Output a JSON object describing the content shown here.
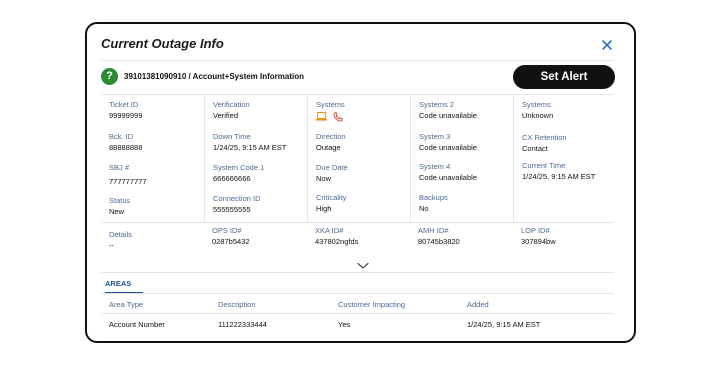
{
  "modal": {
    "title": "Current Outage Info",
    "account_line": "39101381090910 / Account+System Information",
    "set_alert_label": "Set Alert"
  },
  "fields": {
    "ticket_id": {
      "label": "Ticket ID",
      "value": "99999999"
    },
    "bck_id": {
      "label": "Bck. ID",
      "value": "88888888"
    },
    "sbj": {
      "label": "SBJ #",
      "value": "777777777"
    },
    "status": {
      "label": "Status",
      "value": "New"
    },
    "details": {
      "label": "Details",
      "value": "--"
    },
    "verification": {
      "label": "Verification",
      "value": "Verified"
    },
    "down_time": {
      "label": "Down Time",
      "value": "1/24/25, 9:15 AM EST"
    },
    "system_code_1": {
      "label": "System Code 1",
      "value": "666666666"
    },
    "connection_id": {
      "label": "Connection ID",
      "value": "555555555"
    },
    "ops_id": {
      "label": "OPS ID#",
      "value": "0287b5432"
    },
    "systems_icons": {
      "label": "Systems"
    },
    "direction": {
      "label": "Direction",
      "value": "Outage"
    },
    "due_date": {
      "label": "Due Date",
      "value": "Now"
    },
    "criticality": {
      "label": "Criticality",
      "value": "High"
    },
    "xka_id": {
      "label": "XKA ID#",
      "value": "437802ngfds"
    },
    "systems_2": {
      "label": "Systems 2",
      "value": "Code unavailable"
    },
    "system_3": {
      "label": "System 3",
      "value": "Code unavailable"
    },
    "system_4": {
      "label": "System 4",
      "value": "Code unavailable"
    },
    "backups": {
      "label": "Backups",
      "value": "No"
    },
    "amh_id": {
      "label": "AMH ID#",
      "value": "80745b3820"
    },
    "systems_unknown": {
      "label": "Systems",
      "value": "Unknown"
    },
    "cx_retention": {
      "label": "CX Retention",
      "value": "Contact"
    },
    "current_time": {
      "label": "Current Time",
      "value": "1/24/25, 9:15 AM EST"
    },
    "lop_id": {
      "label": "LOP ID#",
      "value": "307894bw"
    }
  },
  "icons": {
    "laptop": "laptop-icon",
    "phone": "phone-icon",
    "close": "close-icon",
    "expand": "chevron-down-icon",
    "status": "question-icon"
  },
  "colors": {
    "label_blue": "#4a6a96",
    "tab_blue": "#1e4f9a",
    "status_green": "#2e8b34",
    "laptop_orange": "#e8961e",
    "phone_red": "#d33a2c",
    "close_blue": "#2f6fc4"
  },
  "areas": {
    "tab_label": "AREAS",
    "headers": [
      "Area Type",
      "Description",
      "Customer Impacting",
      "Added"
    ],
    "rows": [
      [
        "Account Number",
        "111222333444",
        "Yes",
        "1/24/25, 9:15 AM EST"
      ]
    ]
  }
}
